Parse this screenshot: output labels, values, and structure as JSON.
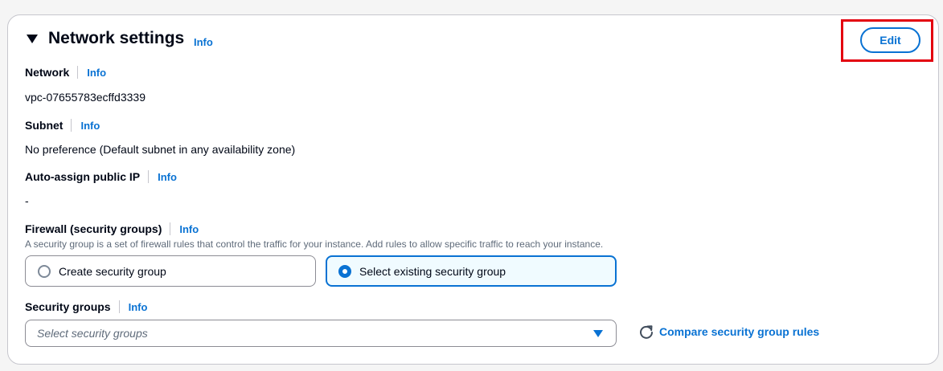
{
  "header": {
    "title": "Network settings",
    "info": "Info",
    "edit_label": "Edit"
  },
  "network": {
    "label": "Network",
    "info": "Info",
    "value": "vpc-07655783ecffd3339"
  },
  "subnet": {
    "label": "Subnet",
    "info": "Info",
    "value": "No preference (Default subnet in any availability zone)"
  },
  "public_ip": {
    "label": "Auto-assign public IP",
    "info": "Info",
    "value": "-"
  },
  "firewall": {
    "label": "Firewall (security groups)",
    "info": "Info",
    "description": "A security group is a set of firewall rules that control the traffic for your instance. Add rules to allow specific traffic to reach your instance.",
    "options": [
      {
        "label": "Create security group",
        "selected": false
      },
      {
        "label": "Select existing security group",
        "selected": true
      }
    ]
  },
  "security_groups": {
    "label": "Security groups",
    "info": "Info",
    "placeholder": "Select security groups",
    "compare_link": "Compare security group rules"
  },
  "icons": {
    "collapse": "caret-down-icon",
    "dropdown": "dropdown-caret-icon",
    "compare": "refresh-icon"
  },
  "colors": {
    "link": "#0972d3",
    "highlight": "#e3000f",
    "selected_bg": "#f0fbff"
  }
}
